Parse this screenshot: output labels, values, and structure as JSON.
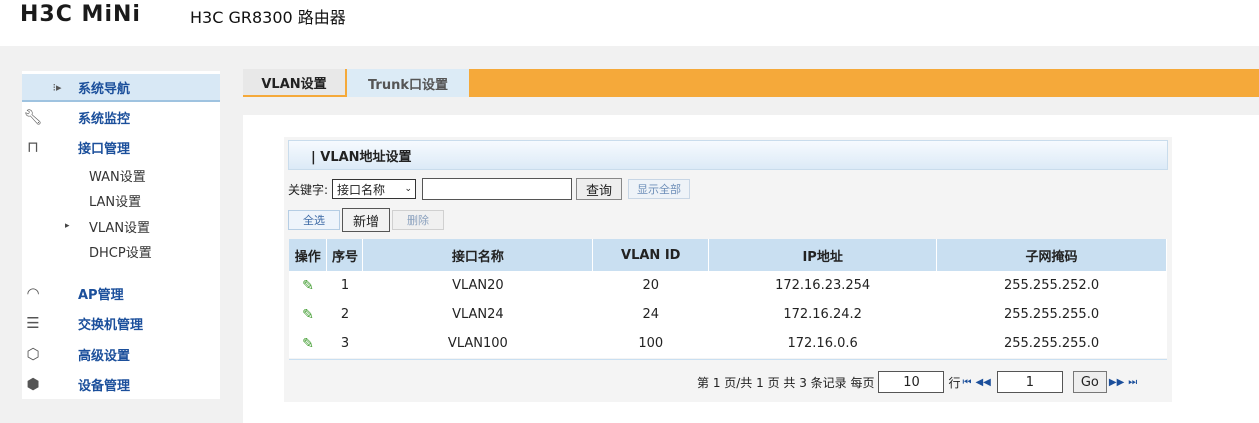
{
  "header": {
    "logo": "H3C",
    "logo_mini": "MiNi",
    "product": "H3C GR8300 路由器"
  },
  "sidebar": {
    "items": [
      {
        "label": "系统导航",
        "icon": "navigation-icon",
        "active": true
      },
      {
        "label": "系统监控",
        "icon": "wrench-icon"
      },
      {
        "label": "接口管理",
        "icon": "interface-icon"
      },
      {
        "label": "AP管理",
        "icon": "wifi-icon"
      },
      {
        "label": "交换机管理",
        "icon": "switch-icon"
      },
      {
        "label": "高级设置",
        "icon": "advanced-icon"
      },
      {
        "label": "设备管理",
        "icon": "box-icon"
      }
    ],
    "subitems": [
      "WAN设置",
      "LAN设置",
      "VLAN设置",
      "DHCP设置"
    ]
  },
  "tabs": [
    {
      "label": "VLAN设置",
      "active": true
    },
    {
      "label": "Trunk口设置"
    }
  ],
  "panel": {
    "title": "| VLAN地址设置",
    "keyword_label": "关键字:",
    "keyword_select": "接口名称",
    "search_value": "",
    "query_button": "查询",
    "show_all_button": "显示全部",
    "select_all_button": "全选",
    "add_button": "新增",
    "delete_button": "删除"
  },
  "table": {
    "headers": [
      "操作",
      "序号",
      "接口名称",
      "VLAN ID",
      "IP地址",
      "子网掩码"
    ],
    "rows": [
      {
        "no": "1",
        "name": "VLAN20",
        "vlan_id": "20",
        "ip": "172.16.23.254",
        "mask": "255.255.252.0"
      },
      {
        "no": "2",
        "name": "VLAN24",
        "vlan_id": "24",
        "ip": "172.16.24.2",
        "mask": "255.255.255.0"
      },
      {
        "no": "3",
        "name": "VLAN100",
        "vlan_id": "100",
        "ip": "172.16.0.6",
        "mask": "255.255.255.0"
      }
    ]
  },
  "pager": {
    "summary": "第 1 页/共 1 页 共 3 条记录 每页",
    "per_page": "10",
    "row_unit": "行",
    "first": "⏮",
    "prev": "◀◀",
    "page": "1",
    "go": "Go",
    "next": "▶▶",
    "last": "⏭"
  },
  "colors": {
    "accent": "#f5a93a",
    "header_blue": "#c9dff1",
    "link_blue": "#1b4f9b"
  }
}
